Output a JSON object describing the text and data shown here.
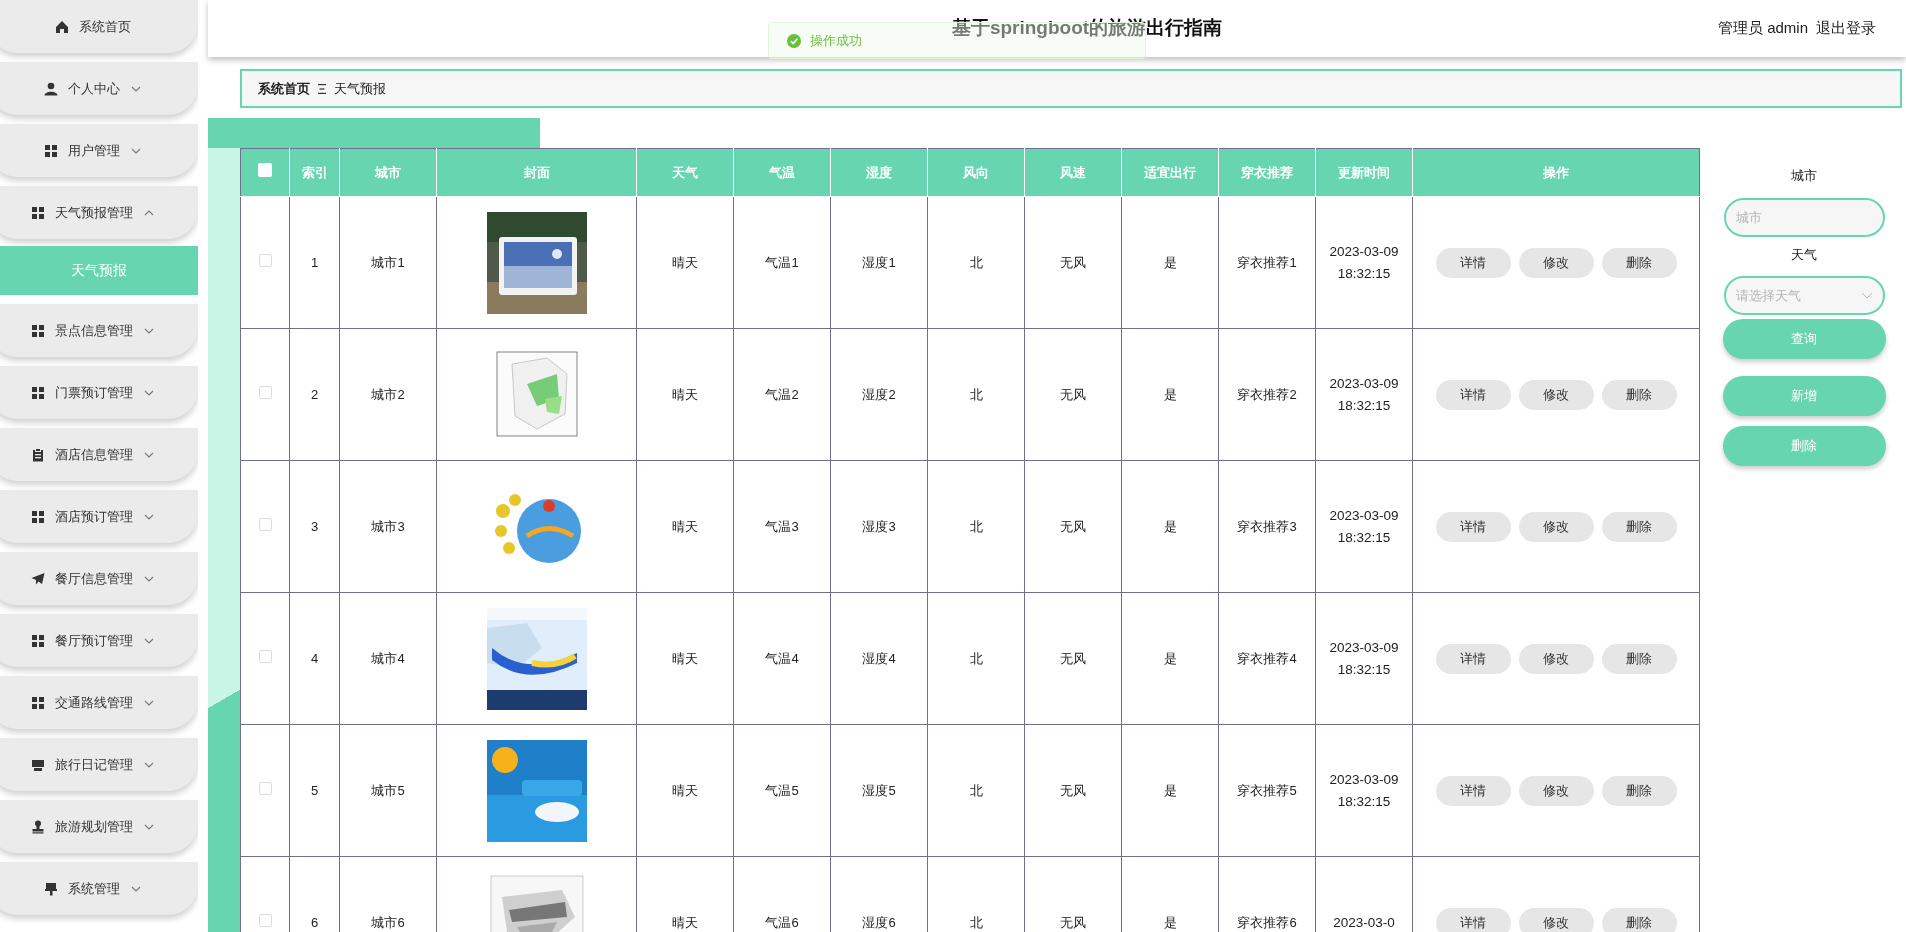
{
  "header": {
    "title": "基于springboot的旅游出行指南",
    "user_label": "管理员 admin",
    "logout": "退出登录"
  },
  "toast": {
    "text": "操作成功"
  },
  "sidebar": {
    "items": [
      {
        "label": "系统首页",
        "kind": "link"
      },
      {
        "label": "个人中心",
        "kind": "menu",
        "expanded": false
      },
      {
        "label": "用户管理",
        "kind": "menu",
        "expanded": false
      },
      {
        "label": "天气预报管理",
        "kind": "menu",
        "expanded": true,
        "children": [
          {
            "label": "天气预报",
            "selected": true
          }
        ]
      },
      {
        "label": "景点信息管理",
        "kind": "menu",
        "expanded": false
      },
      {
        "label": "门票预订管理",
        "kind": "menu",
        "expanded": false
      },
      {
        "label": "酒店信息管理",
        "kind": "menu",
        "expanded": false
      },
      {
        "label": "酒店预订管理",
        "kind": "menu",
        "expanded": false
      },
      {
        "label": "餐厅信息管理",
        "kind": "menu",
        "expanded": false
      },
      {
        "label": "餐厅预订管理",
        "kind": "menu",
        "expanded": false
      },
      {
        "label": "交通路线管理",
        "kind": "menu",
        "expanded": false
      },
      {
        "label": "旅行日记管理",
        "kind": "menu",
        "expanded": false
      },
      {
        "label": "旅游规划管理",
        "kind": "menu",
        "expanded": false
      },
      {
        "label": "系统管理",
        "kind": "menu",
        "expanded": false
      }
    ]
  },
  "breadcrumb": [
    "系统首页",
    "天气预报"
  ],
  "table": {
    "select_all": {
      "checked": false
    },
    "columns": [
      "索引",
      "城市",
      "封面",
      "天气",
      "气温",
      "湿度",
      "风向",
      "风速",
      "适宜出行",
      "穿衣推荐",
      "更新时间",
      "操作"
    ],
    "rows": [
      {
        "checked": false,
        "index": "1",
        "city": "城市1",
        "weather": "晴天",
        "temperature": "气温1",
        "humidity": "湿度1",
        "wind_direction": "北",
        "wind_speed": "无风",
        "suitable": "是",
        "clothing": "穿衣推荐1",
        "updated": "2023-03-09 18:32:15",
        "actions": [
          "详情",
          "修改",
          "删除"
        ]
      },
      {
        "checked": false,
        "index": "2",
        "city": "城市2",
        "weather": "晴天",
        "temperature": "气温2",
        "humidity": "湿度2",
        "wind_direction": "北",
        "wind_speed": "无风",
        "suitable": "是",
        "clothing": "穿衣推荐2",
        "updated": "2023-03-09 18:32:15",
        "actions": [
          "详情",
          "修改",
          "删除"
        ]
      },
      {
        "checked": false,
        "index": "3",
        "city": "城市3",
        "weather": "晴天",
        "temperature": "气温3",
        "humidity": "湿度3",
        "wind_direction": "北",
        "wind_speed": "无风",
        "suitable": "是",
        "clothing": "穿衣推荐3",
        "updated": "2023-03-09 18:32:15",
        "actions": [
          "详情",
          "修改",
          "删除"
        ]
      },
      {
        "checked": false,
        "index": "4",
        "city": "城市4",
        "weather": "晴天",
        "temperature": "气温4",
        "humidity": "湿度4",
        "wind_direction": "北",
        "wind_speed": "无风",
        "suitable": "是",
        "clothing": "穿衣推荐4",
        "updated": "2023-03-09 18:32:15",
        "actions": [
          "详情",
          "修改",
          "删除"
        ]
      },
      {
        "checked": false,
        "index": "5",
        "city": "城市5",
        "weather": "晴天",
        "temperature": "气温5",
        "humidity": "湿度5",
        "wind_direction": "北",
        "wind_speed": "无风",
        "suitable": "是",
        "clothing": "穿衣推荐5",
        "updated": "2023-03-09 18:32:15",
        "actions": [
          "详情",
          "修改",
          "删除"
        ]
      },
      {
        "checked": false,
        "index": "6",
        "city": "城市6",
        "weather": "晴天",
        "temperature": "气温6",
        "humidity": "湿度6",
        "wind_direction": "北",
        "wind_speed": "无风",
        "suitable": "是",
        "clothing": "穿衣推荐6",
        "updated": "2023-03-0",
        "actions": [
          "详情",
          "修改",
          "删除"
        ]
      }
    ]
  },
  "search": {
    "fields": [
      {
        "label": "城市",
        "kind": "input",
        "placeholder": "城市"
      },
      {
        "label": "天气",
        "kind": "select",
        "placeholder": "请选择天气"
      }
    ],
    "query_button": "查询",
    "buttons": [
      "新增",
      "删除"
    ]
  }
}
